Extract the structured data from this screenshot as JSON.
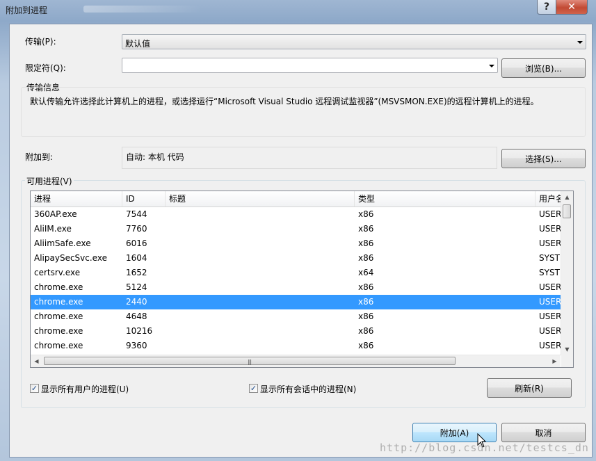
{
  "window": {
    "title": "附加到进程",
    "help_glyph": "?",
    "close_glyph": "✕"
  },
  "transport": {
    "label": "传输(P):",
    "value": "默认值"
  },
  "qualifier": {
    "label": "限定符(Q):",
    "value": "",
    "browse_label": "浏览(B)..."
  },
  "transport_info": {
    "title": "传输信息",
    "text": "默认传输允许选择此计算机上的进程，或选择运行“Microsoft Visual Studio 远程调试监视器”(MSVSMON.EXE)的远程计算机上的进程。"
  },
  "attach_to": {
    "label": "附加到:",
    "value": "自动: 本机 代码",
    "select_label": "选择(S)..."
  },
  "processes": {
    "title": "可用进程(V)",
    "columns": [
      "进程",
      "ID",
      "标题",
      "类型",
      "用户名"
    ],
    "rows": [
      {
        "name": "360AP.exe",
        "id": "7544",
        "title": "",
        "type": "x86",
        "user": "USER",
        "selected": false
      },
      {
        "name": "AliIM.exe",
        "id": "7760",
        "title": "",
        "type": "x86",
        "user": "USER",
        "selected": false
      },
      {
        "name": "AliimSafe.exe",
        "id": "6016",
        "title": "",
        "type": "x86",
        "user": "USER",
        "selected": false
      },
      {
        "name": "AlipaySecSvc.exe",
        "id": "1604",
        "title": "",
        "type": "x86",
        "user": "SYST",
        "selected": false
      },
      {
        "name": "certsrv.exe",
        "id": "1652",
        "title": "",
        "type": "x64",
        "user": "SYST",
        "selected": false
      },
      {
        "name": "chrome.exe",
        "id": "5124",
        "title": "",
        "type": "x86",
        "user": "USER",
        "selected": false
      },
      {
        "name": "chrome.exe",
        "id": "2440",
        "title": "",
        "type": "x86",
        "user": "USER",
        "selected": true
      },
      {
        "name": "chrome.exe",
        "id": "4648",
        "title": "",
        "type": "x86",
        "user": "USER",
        "selected": false
      },
      {
        "name": "chrome.exe",
        "id": "10216",
        "title": "",
        "type": "x86",
        "user": "USER",
        "selected": false
      },
      {
        "name": "chrome.exe",
        "id": "9360",
        "title": "",
        "type": "x86",
        "user": "USER",
        "selected": false
      }
    ],
    "show_all_users_label": "显示所有用户的进程(U)",
    "show_all_users_checked": true,
    "show_all_sessions_label": "显示所有会话中的进程(N)",
    "show_all_sessions_checked": true,
    "refresh_label": "刷新(R)"
  },
  "footer": {
    "attach_label": "附加(A)",
    "cancel_label": "取消"
  },
  "watermark": "http://blog.csdn.net/testcs_dn",
  "colors": {
    "selection": "#3399ff",
    "primary_button_border": "#3c7fb1"
  }
}
